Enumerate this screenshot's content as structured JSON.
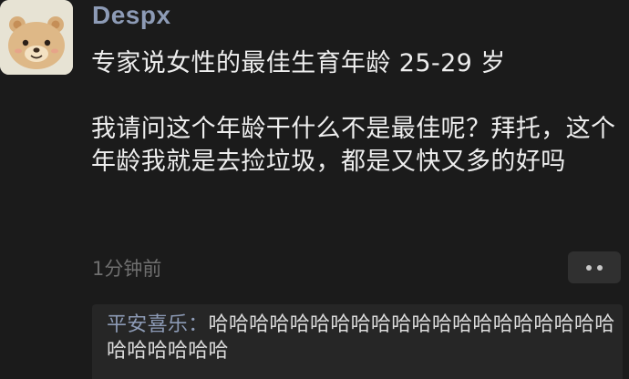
{
  "post": {
    "username": "Despx",
    "paragraph1": "专家说女性的最佳生育年龄 25-29 岁",
    "paragraph2": "我请问这个年龄干什么不是最佳呢？拜托，这个年龄我就是去捡垃圾，都是又快又多的好吗",
    "timestamp": "1分钟前"
  },
  "comment": {
    "author": "平安喜乐",
    "separator": "：",
    "text": "哈哈哈哈哈哈哈哈哈哈哈哈哈哈哈哈哈哈哈哈哈哈哈哈哈哈"
  },
  "icons": {
    "avatar": "bear-avatar-icon",
    "more": "more-dots-icon"
  },
  "colors": {
    "background": "#1b1b1b",
    "username": "#8d9bb6",
    "text": "#eeeeee",
    "meta": "#6f6f6f",
    "comment_bg": "#262626"
  }
}
